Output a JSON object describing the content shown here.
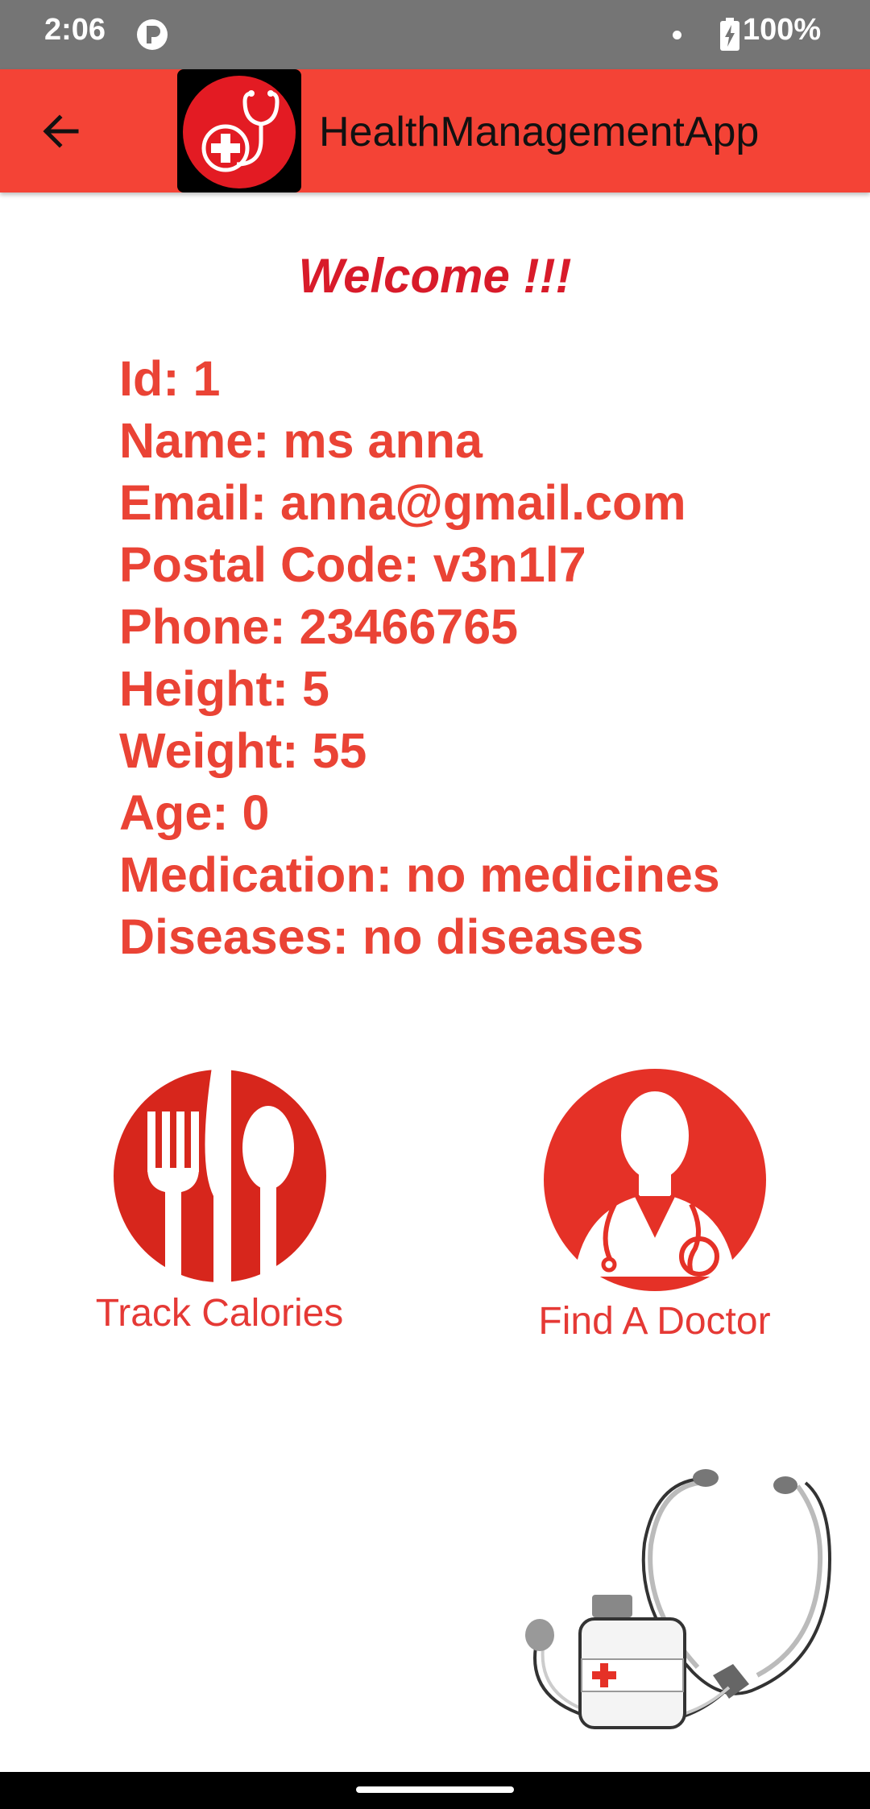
{
  "status_bar": {
    "time": "2:06",
    "battery": "100%",
    "icons": [
      "app-notification-icon",
      "dot-icon",
      "battery-charging-icon"
    ]
  },
  "app_bar": {
    "title": "HealthManagementApp",
    "back_icon": "arrow-back-icon",
    "logo_icon": "stethoscope-cross-logo",
    "background": "#f44336"
  },
  "welcome": "Welcome !!!",
  "profile": {
    "id": "Id: 1",
    "name": "Name: ms anna",
    "email": "Email: anna@gmail.com",
    "postal_code": "Postal Code: v3n1l7",
    "phone": "Phone: 23466765",
    "height": "Height: 5",
    "weight": "Weight: 55",
    "age": "Age: 0",
    "medication": "Medication: no medicines",
    "diseases": "Diseases: no diseases"
  },
  "actions": {
    "track_calories": {
      "label": "Track Calories",
      "icon": "fork-knife-spoon-icon"
    },
    "find_doctor": {
      "label": "Find A Doctor",
      "icon": "doctor-icon"
    }
  },
  "decoration": {
    "icon": "stethoscope-medicine-bottle-illustration"
  },
  "colors": {
    "accent": "#f44336",
    "text_red": "#ea4335",
    "welcome_red": "#d81b2a"
  }
}
